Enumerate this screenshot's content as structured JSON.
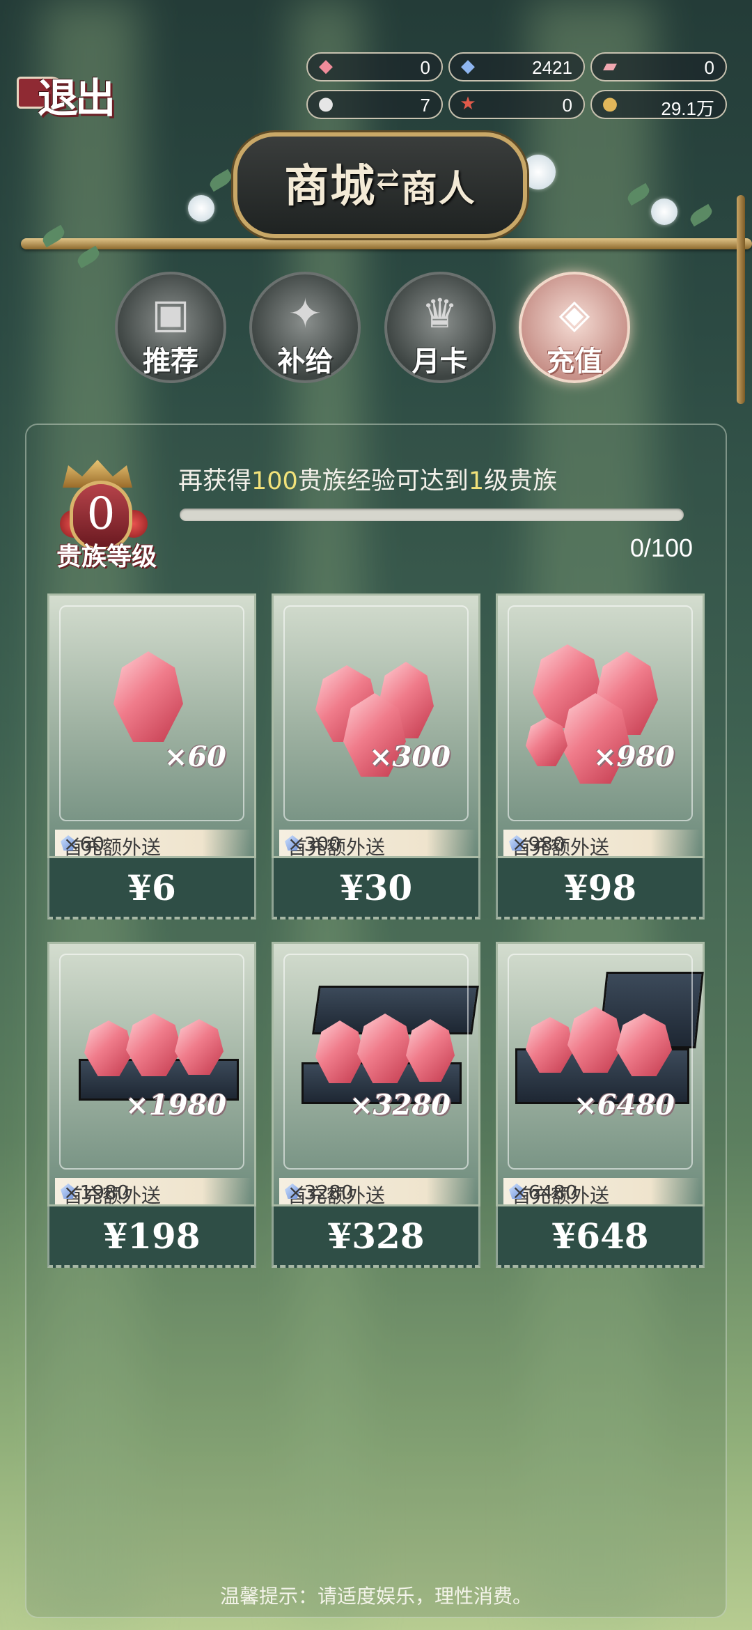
{
  "exit_label": "退出",
  "currencies": [
    {
      "icon": "pink-crystal-icon",
      "glyph": "◆",
      "color": "#f08c9a",
      "value": "0"
    },
    {
      "icon": "blue-gem-icon",
      "glyph": "◆",
      "color": "#8fb6f0",
      "value": "2421"
    },
    {
      "icon": "pink-ticket-icon",
      "glyph": "▰",
      "color": "#f0a8b0",
      "value": "0"
    },
    {
      "icon": "button-token-icon",
      "glyph": "●",
      "color": "#e6e6e6",
      "value": "7"
    },
    {
      "icon": "star-medal-icon",
      "glyph": "★",
      "color": "#e05a4a",
      "value": "0"
    },
    {
      "icon": "gold-coin-icon",
      "glyph": "●",
      "color": "#e2b75a",
      "value": "29.1万"
    }
  ],
  "sign": {
    "title": "商城",
    "arrow": "⇄",
    "subtitle": "商人"
  },
  "tabs": [
    {
      "label": "推荐",
      "glyph": "▣",
      "active": false
    },
    {
      "label": "补给",
      "glyph": "✦",
      "active": false
    },
    {
      "label": "月卡",
      "glyph": "♛",
      "active": false
    },
    {
      "label": "充值",
      "glyph": "◈",
      "active": true
    }
  ],
  "noble": {
    "level": "0",
    "label": "贵族等级",
    "msg_prefix": "再获得",
    "msg_exp": "100",
    "msg_mid": "贵族经验可达到",
    "msg_level": "1",
    "msg_suffix": "级贵族",
    "progress_text": "0/100",
    "progress_fraction": 0
  },
  "products": [
    {
      "qty": "×60",
      "bonus_label": "首充额外送",
      "bonus_qty": "×60",
      "price": "¥6"
    },
    {
      "qty": "×300",
      "bonus_label": "首充额外送",
      "bonus_qty": "×300",
      "price": "¥30"
    },
    {
      "qty": "×980",
      "bonus_label": "首充额外送",
      "bonus_qty": "×980",
      "price": "¥98"
    },
    {
      "qty": "×1980",
      "bonus_label": "首充额外送",
      "bonus_qty": "×1980",
      "price": "¥198"
    },
    {
      "qty": "×3280",
      "bonus_label": "首充额外送",
      "bonus_qty": "×3280",
      "price": "¥328"
    },
    {
      "qty": "×6480",
      "bonus_label": "首充额外送",
      "bonus_qty": "×6480",
      "price": "¥648"
    }
  ],
  "footer_tip": "温馨提示：请适度娱乐，理性消费。"
}
